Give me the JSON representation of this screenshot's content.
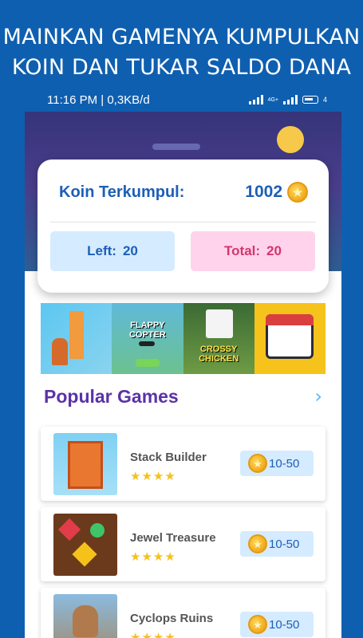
{
  "promo": {
    "line1": "MAINKAN GAMENYA KUMPULKAN",
    "line2": "KOIN DAN TUKAR SALDO DANA"
  },
  "status_bar": {
    "time_speed": "11:16 PM | 0,3KB/d",
    "network_badge": "4G+",
    "battery": "4"
  },
  "coins": {
    "label": "Koin Terkumpul:",
    "value": "1002"
  },
  "left": {
    "label": "Left:",
    "value": "20"
  },
  "total": {
    "label": "Total:",
    "value": "20"
  },
  "featured_thumbs": [
    {
      "label": ""
    },
    {
      "label": "FLAPPY COPTER"
    },
    {
      "label": "CROSSY CHICKEN"
    },
    {
      "label": ""
    }
  ],
  "popular": {
    "title": "Popular Games"
  },
  "games": [
    {
      "name": "Stack Builder",
      "stars": "★★★★",
      "reward": "10-50"
    },
    {
      "name": "Jewel Treasure",
      "stars": "★★★★",
      "reward": "10-50"
    },
    {
      "name": "Cyclops Ruins",
      "stars": "★★★★",
      "reward": "10-50"
    }
  ],
  "colors": {
    "background": "#0f5fb0",
    "accent_blue": "#1d5fb6",
    "accent_pink": "#d2366e",
    "title_purple": "#5b32a8",
    "coin_gold": "#f0a91c"
  },
  "icons": [
    "coin-star-icon",
    "chevron-right-icon",
    "signal-icon",
    "battery-icon"
  ]
}
